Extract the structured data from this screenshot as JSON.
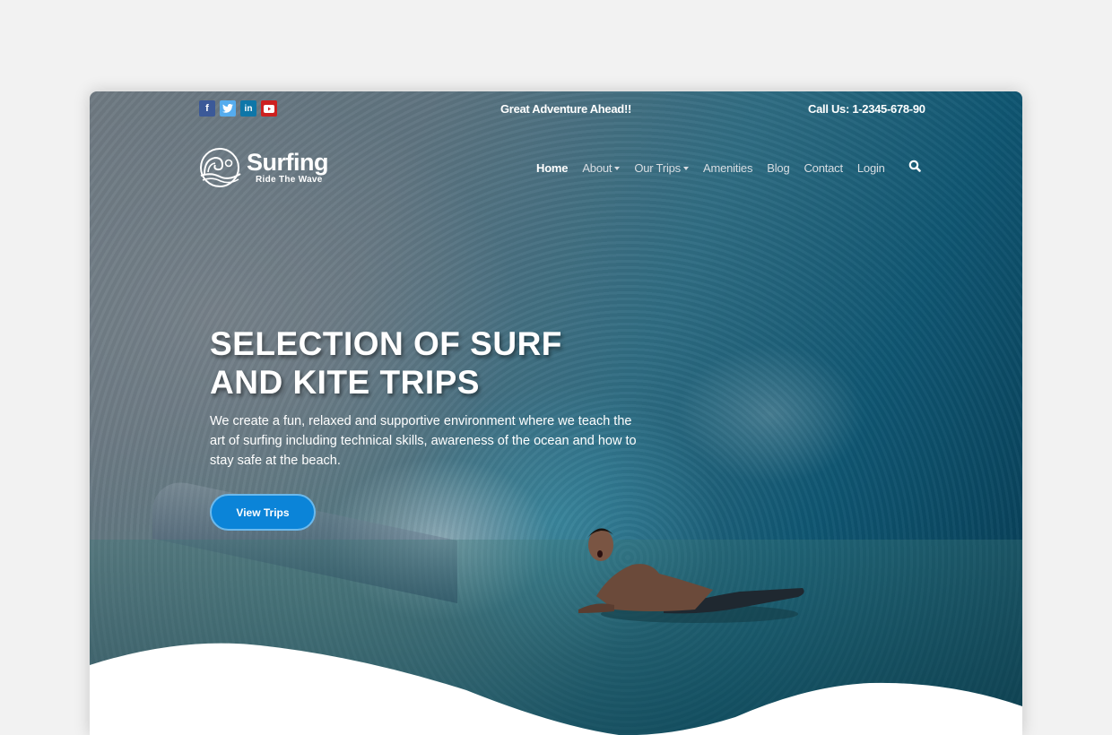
{
  "topbar": {
    "socials": [
      {
        "name": "facebook",
        "glyph": "f",
        "color": "#3b5998"
      },
      {
        "name": "twitter",
        "glyph": "t",
        "color": "#55acee"
      },
      {
        "name": "linkedin",
        "glyph": "in",
        "color": "#0e76a8"
      },
      {
        "name": "youtube",
        "glyph": "▶",
        "color": "#cd201f"
      }
    ],
    "tagline": "Great Adventure Ahead!!",
    "call_us": "Call Us: 1-2345-678-90"
  },
  "logo": {
    "name": "Surfing",
    "subtitle": "Ride The Wave"
  },
  "nav": {
    "items": [
      {
        "label": "Home",
        "active": true,
        "dropdown": false
      },
      {
        "label": "About",
        "active": false,
        "dropdown": true
      },
      {
        "label": "Our Trips",
        "active": false,
        "dropdown": true
      },
      {
        "label": "Amenities",
        "active": false,
        "dropdown": false
      },
      {
        "label": "Blog",
        "active": false,
        "dropdown": false
      },
      {
        "label": "Contact",
        "active": false,
        "dropdown": false
      },
      {
        "label": "Login",
        "active": false,
        "dropdown": false
      }
    ],
    "search_icon": "search-icon"
  },
  "hero": {
    "headline_line1": "SELECTION OF SURF",
    "headline_line2": "AND KITE TRIPS",
    "description": "We create a fun, relaxed and supportive environment where we teach the art of surfing including technical skills, awareness of the ocean and how to stay safe at the beach.",
    "cta_label": "View Trips",
    "cta_color": "#0b84d8"
  }
}
